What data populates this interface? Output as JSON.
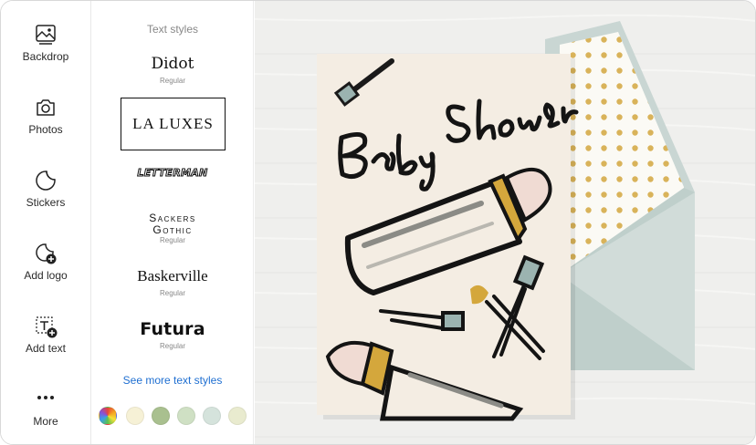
{
  "sidebar": {
    "items": [
      {
        "label": "Backdrop",
        "icon": "backdrop-icon"
      },
      {
        "label": "Photos",
        "icon": "camera-icon"
      },
      {
        "label": "Stickers",
        "icon": "sticker-icon"
      },
      {
        "label": "Add logo",
        "icon": "add-logo-icon"
      },
      {
        "label": "Add text",
        "icon": "add-text-icon"
      },
      {
        "label": "More",
        "icon": "more-dots-icon"
      }
    ]
  },
  "text_panel": {
    "title": "Text styles",
    "options": [
      {
        "name": "Didot",
        "sub": "Regular",
        "selected": false
      },
      {
        "name": "LA LUXES",
        "sub": "",
        "selected": true
      },
      {
        "name": "LETTERMAN",
        "sub": "",
        "selected": false
      },
      {
        "name_line1": "Sackers",
        "name_line2": "Gothic",
        "sub": "Regular",
        "selected": false
      },
      {
        "name": "Baskerville",
        "sub": "Regular",
        "selected": false
      },
      {
        "name": "Futura",
        "sub": "Regular",
        "selected": false
      }
    ],
    "see_more": "See more text styles",
    "swatches": [
      "rainbow",
      "#f6f1d6",
      "#a9c08f",
      "#cfe0c4",
      "#d5e3dc",
      "#e9ebcf"
    ]
  },
  "card": {
    "title_text": "Baby Shower",
    "background": "#f4ede3",
    "envelope_color": "#c9d6d3",
    "liner_dot_color": "#d9b35a"
  },
  "colors": {
    "link": "#1f6fd1",
    "canvas_bg": "#eeeeec"
  }
}
